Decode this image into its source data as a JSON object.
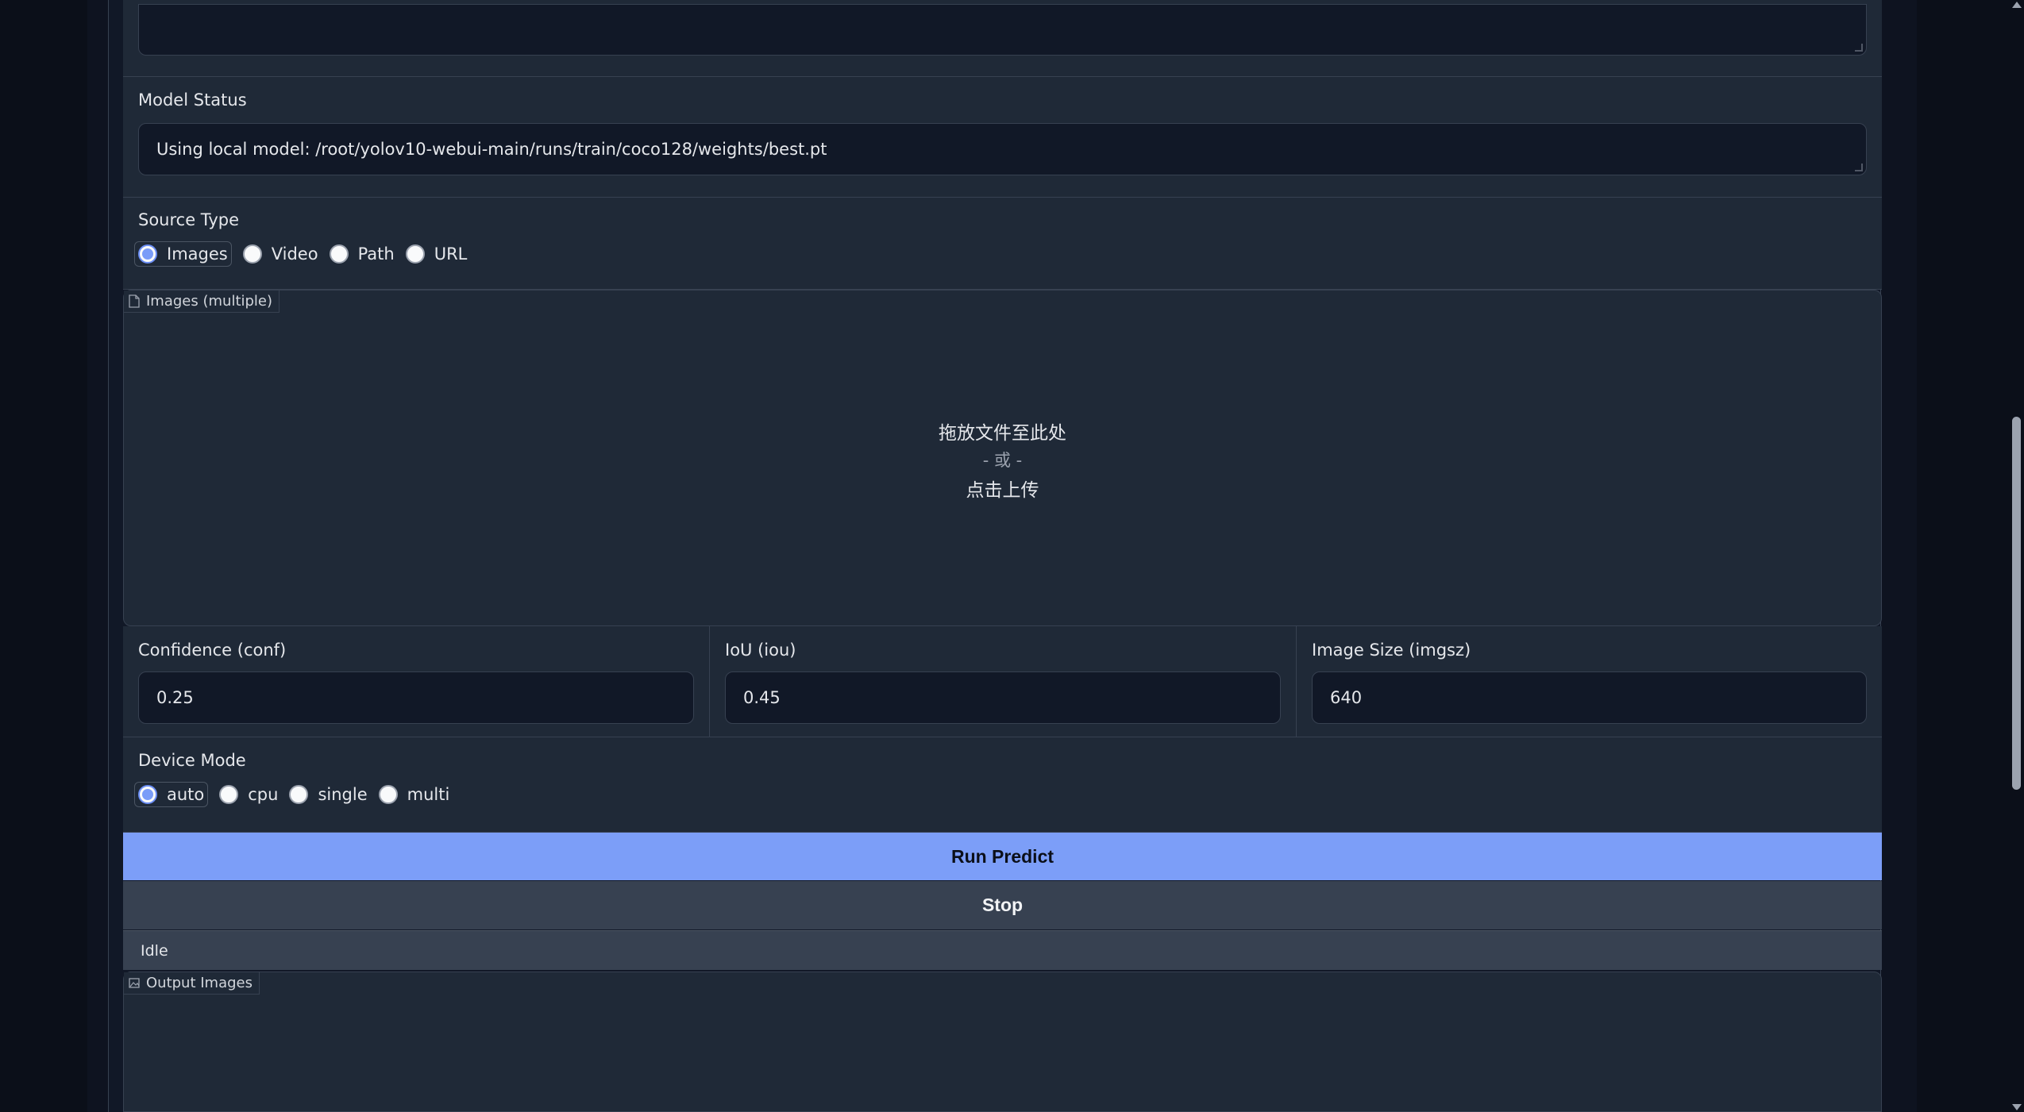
{
  "model_status": {
    "label": "Model Status",
    "value": "Using local model: /root/yolov10-webui-main/runs/train/coco128/weights/best.pt"
  },
  "source_type": {
    "label": "Source Type",
    "options": [
      "Images",
      "Video",
      "Path",
      "URL"
    ],
    "selected": "Images"
  },
  "upload": {
    "tag_label": "Images (multiple)",
    "tag_icon": "file-icon",
    "drop_line1": "拖放文件至此处",
    "drop_or": "- 或 -",
    "drop_line2": "点击上传"
  },
  "params": {
    "conf": {
      "label": "Confidence (conf)",
      "value": "0.25"
    },
    "iou": {
      "label": "IoU (iou)",
      "value": "0.45"
    },
    "imgsz": {
      "label": "Image Size (imgsz)",
      "value": "640"
    }
  },
  "device_mode": {
    "label": "Device Mode",
    "options": [
      "auto",
      "cpu",
      "single",
      "multi"
    ],
    "selected": "auto"
  },
  "buttons": {
    "run_label": "Run Predict",
    "stop_label": "Stop"
  },
  "status": "Idle",
  "output": {
    "tag_label": "Output Images",
    "tag_icon": "image-icon"
  },
  "colors": {
    "primary": "#7c9ef8",
    "panel": "#1f2937",
    "background": "#0b0f19"
  }
}
